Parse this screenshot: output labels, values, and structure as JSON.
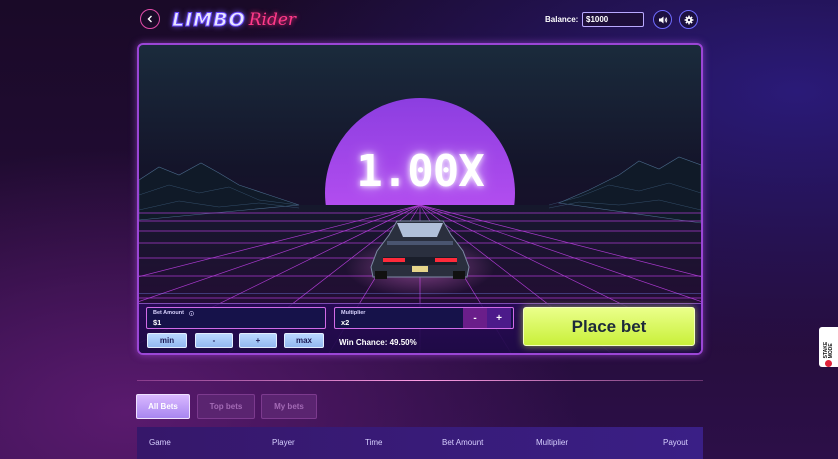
{
  "header": {
    "logo_part1": "LIMBO",
    "logo_part2": "Rider",
    "balance_label": "Balance:",
    "balance_value": "$1000"
  },
  "icons": {
    "back": "chevron-left-icon",
    "sound": "speaker-icon",
    "settings": "gear-icon"
  },
  "game": {
    "multiplier": "1.00X",
    "plate_text": "LIMBO"
  },
  "controls": {
    "bet_amount_label": "Bet Amount",
    "bet_amount_value": "$1",
    "multiplier_label": "Multiplier",
    "multiplier_value": "x2",
    "decrease_label": "-",
    "increase_label": "+",
    "quick_buttons": [
      "min",
      "-",
      "+",
      "max"
    ],
    "win_chance": "Win Chance: 49.50%",
    "place_bet_label": "Place bet"
  },
  "tabs": [
    {
      "label": "All Bets",
      "active": true
    },
    {
      "label": "Top bets",
      "active": false
    },
    {
      "label": "My bets",
      "active": false
    }
  ],
  "table": {
    "columns": [
      "Game",
      "Player",
      "Time",
      "Bet Amount",
      "Multiplier",
      "Payout"
    ]
  },
  "side_badge": {
    "text": "STAKE MODE"
  },
  "colors": {
    "accent_pink": "#e04ba8",
    "place_bet_green": "#c9f03a",
    "sun_purple": "#b44ef0",
    "grid_magenta": "#c040e8"
  }
}
